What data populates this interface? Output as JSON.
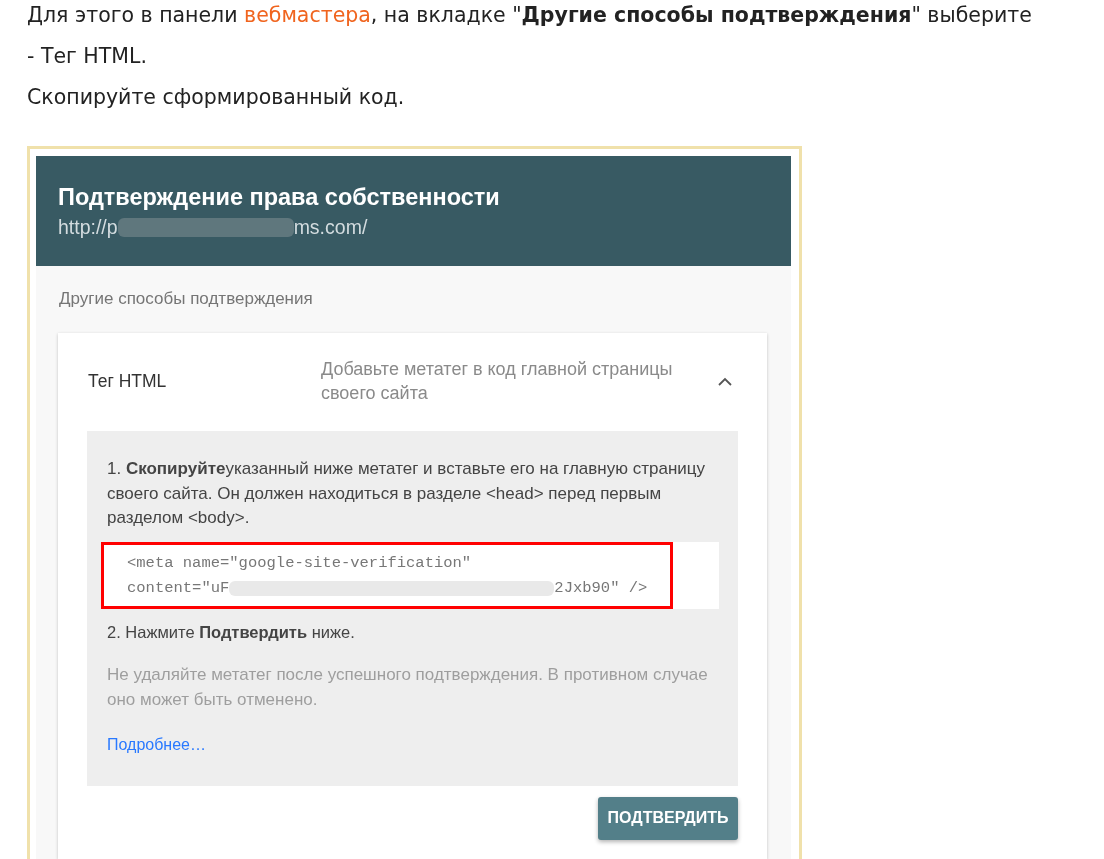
{
  "intro": {
    "paragraph": {
      "before": "Для этого в панели ",
      "link": "вебмастера",
      "after": ", на вкладке \"**Другие способы подтверждения**\" выберите"
    },
    "lines": [
      "- Тег HTML.",
      "Скопируйте сформированный код."
    ]
  },
  "screenshot": {
    "header": {
      "title": "Подтверждение права собственности",
      "url_start": "http://p",
      "url_end": "ms.com/"
    },
    "section_label": "Другие способы подтверждения",
    "method": {
      "name": "Тег HTML",
      "description": "Добавьте метатег в код главной страницы своего сайта",
      "expanded": true,
      "step_1": "1. **Скопируйте**указанный ниже метатег и вставьте его на главную страницу своего сайта. Он должен находиться в разделе <head> перед первым разделом <body>.",
      "code": {
        "line_1": "<meta name=\"google-site-verification\"",
        "line_2_start": "content=\"uF",
        "line_2_end": "2Jxb90\" />",
        "highlighted": true
      },
      "step_2": "2. Нажмите **Подтвердить** ниже.",
      "note": "Не удаляйте метатег после успешного подтверждения. В противном случае оно может быть отменено.",
      "link": "Подробнее…"
    },
    "button": "ПОДТВЕРДИТЬ"
  }
}
